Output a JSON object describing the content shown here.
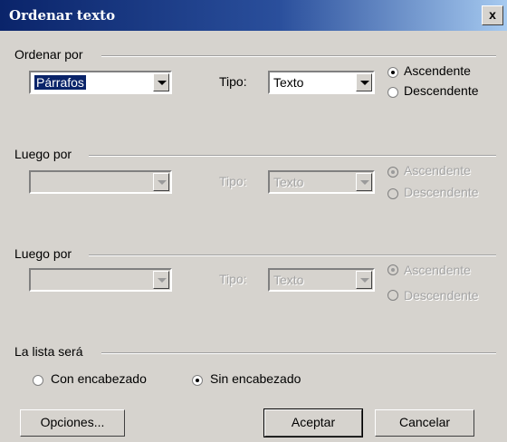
{
  "window": {
    "title": "Ordenar texto",
    "close_label": "x"
  },
  "sort1": {
    "group_label": "Ordenar por",
    "field_value": "Párrafos",
    "tipo_label": "Tipo:",
    "tipo_value": "Texto",
    "asc_label": "Ascendente",
    "desc_label": "Descendente",
    "selected": "asc"
  },
  "sort2": {
    "group_label": "Luego por",
    "field_value": "",
    "tipo_label": "Tipo:",
    "tipo_value": "Texto",
    "asc_label": "Ascendente",
    "desc_label": "Descendente"
  },
  "sort3": {
    "group_label": "Luego por",
    "field_value": "",
    "tipo_label": "Tipo:",
    "tipo_value": "Texto",
    "asc_label": "Ascendente",
    "desc_label": "Descendente"
  },
  "header": {
    "group_label": "La lista será",
    "with_label": "Con encabezado",
    "without_label": "Sin encabezado",
    "selected": "without"
  },
  "buttons": {
    "options": "Opciones...",
    "ok": "Aceptar",
    "cancel": "Cancelar"
  }
}
